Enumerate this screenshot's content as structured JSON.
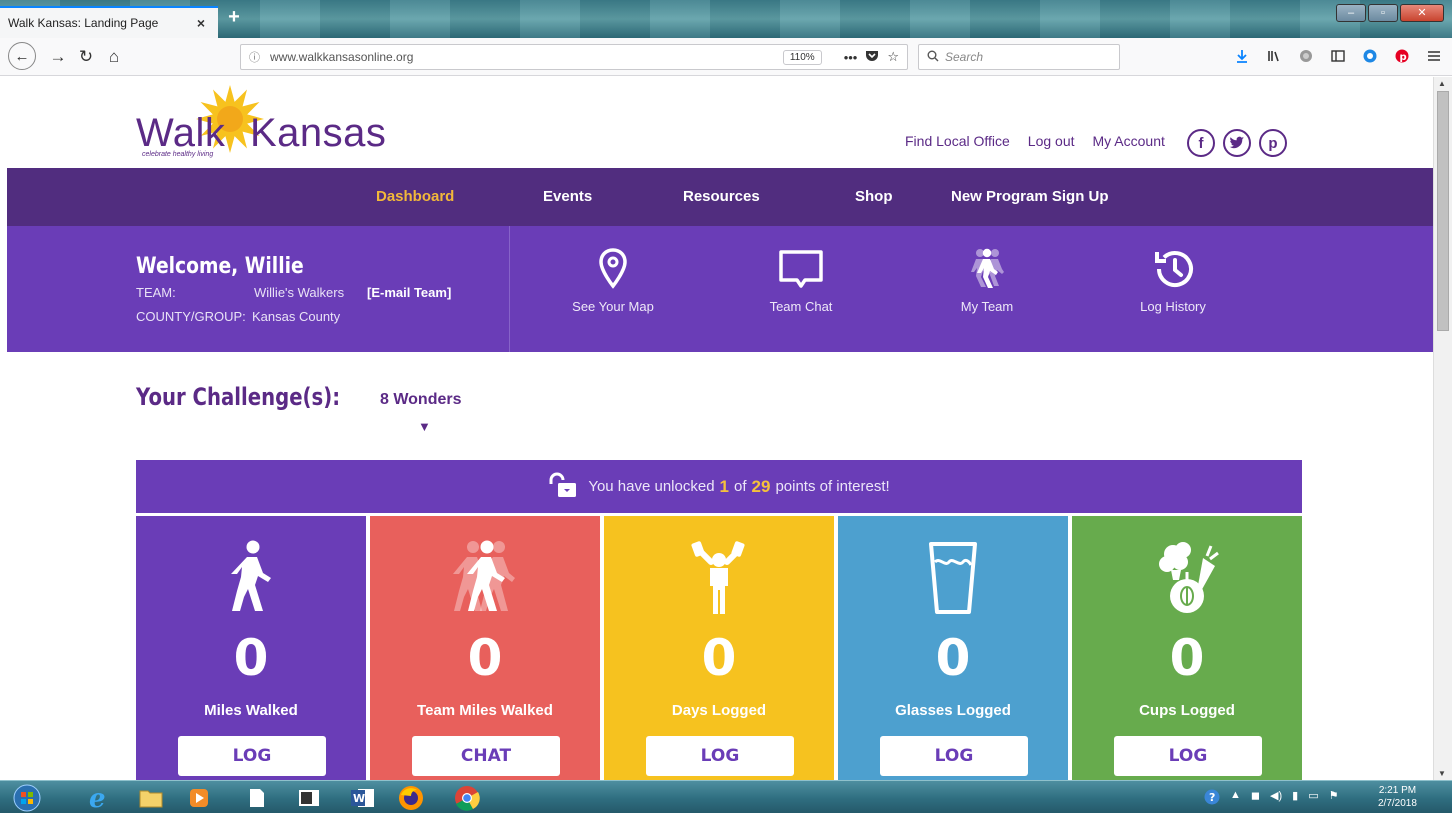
{
  "browser": {
    "tab_title": "Walk Kansas: Landing Page",
    "tab_close": "×",
    "new_tab": "+",
    "url_info": "ⓘ",
    "url": "www.walkkansasonline.org",
    "zoom": "110%",
    "search_placeholder": "Search"
  },
  "header": {
    "logo_word_left": "Walk",
    "logo_word_right": "Kansas",
    "logo_tagline": "celebrate healthy living",
    "links": [
      "Find Local Office",
      "Log out",
      "My Account"
    ],
    "social": [
      "f",
      "t",
      "p"
    ]
  },
  "nav": {
    "items": [
      "Dashboard",
      "Events",
      "Resources",
      "Shop",
      "New Program Sign Up"
    ],
    "active": "Dashboard"
  },
  "welcome": {
    "title": "Welcome, Willie",
    "team_label": "TEAM:",
    "team_value": "Willie's Walkers",
    "email_team": "[E-mail Team]",
    "county_label": "COUNTY/GROUP:",
    "county_value": "Kansas County",
    "quick_links": [
      "See Your Map",
      "Team Chat",
      "My Team",
      "Log History"
    ]
  },
  "challenge": {
    "label": "Your Challenge(s):",
    "selected": "8 Wonders"
  },
  "unlock": {
    "prefix": "You have unlocked",
    "unlocked": "1",
    "of": "of",
    "total": "29",
    "suffix": "points of interest!"
  },
  "tiles": [
    {
      "value": "0",
      "label": "Miles Walked",
      "button": "LOG",
      "color": "#6a3db7",
      "icon": "walker-icon"
    },
    {
      "value": "0",
      "label": "Team Miles Walked",
      "button": "CHAT",
      "color": "#e8605c",
      "icon": "team-walkers-icon"
    },
    {
      "value": "0",
      "label": "Days Logged",
      "button": "LOG",
      "color": "#f6c21f",
      "icon": "weightlifter-icon"
    },
    {
      "value": "0",
      "label": "Glasses Logged",
      "button": "LOG",
      "color": "#4da0cf",
      "icon": "water-glass-icon"
    },
    {
      "value": "0",
      "label": "Cups Logged",
      "button": "LOG",
      "color": "#67ab4d",
      "icon": "fruits-vegetables-icon"
    }
  ],
  "colors": {
    "brand_purple": "#5b2a86",
    "nav_purple": "#512d7f",
    "panel_purple": "#6a3db7",
    "accent_gold": "#f2b83a"
  },
  "taskbar": {
    "time": "2:21 PM",
    "date": "2/7/2018"
  }
}
